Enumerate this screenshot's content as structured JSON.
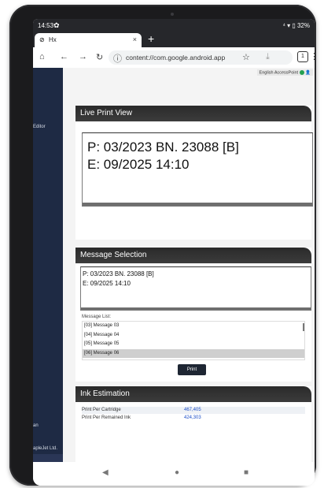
{
  "status": {
    "time": "14:53",
    "gear": "✿",
    "right": "⁴ ▾ ▯ 32%"
  },
  "browser": {
    "tab_title": "Hx",
    "tab_icon": "⊘",
    "close": "×",
    "new_tab": "+",
    "url": "content://com.google.android.app",
    "tab_count": "1"
  },
  "header": {
    "language": "English",
    "access_point": "AccessPoint"
  },
  "sidebar": {
    "editor": "Editor",
    "bottom1": "an",
    "bottom2": "apleJet Ltd."
  },
  "live_print": {
    "title": "Live Print View",
    "line1": "P: 03/2023  BN. 23088 [B]",
    "line2": "E: 09/2025          14:10"
  },
  "message_selection": {
    "title": "Message Selection",
    "line1": "P: 03/2023   BN. 23088 [B]",
    "line2": "E: 09/2025        14:10",
    "list_label": "Message List:",
    "items": [
      "[03] Message 03",
      "[04] Message 04",
      "[05] Message 05",
      "[06] Message 06"
    ],
    "print_label": "Print"
  },
  "ink_estimation": {
    "title": "Ink Estimation",
    "rows": [
      {
        "label": "Print Per Cartridge",
        "value": "467,405"
      },
      {
        "label": "Print Per Remained Ink",
        "value": "424,303"
      }
    ]
  },
  "navbar": {
    "back": "◀",
    "home": "●",
    "recents": "■"
  }
}
